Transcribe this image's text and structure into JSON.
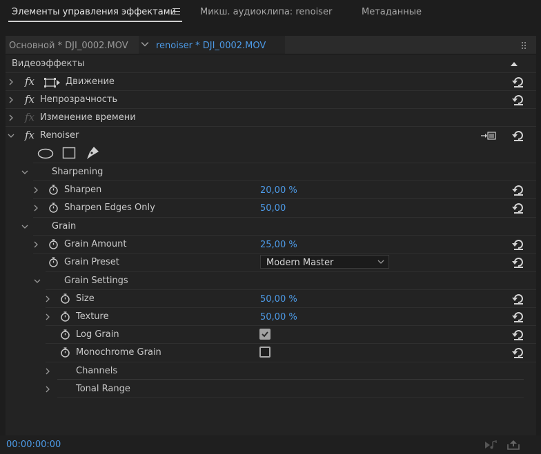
{
  "tabs": [
    {
      "label": "Элементы управления эффектами",
      "active": true
    },
    {
      "label": "Микш. аудиоклипа: renoiser",
      "active": false
    },
    {
      "label": "Метаданные",
      "active": false
    }
  ],
  "sequence": {
    "master": "Основной * DJI_0002.MOV",
    "clip": "renoiser * DJI_0002.MOV"
  },
  "section_header": "Видеоэффекты",
  "effects": {
    "motion": "Движение",
    "opacity": "Непрозрачность",
    "time_remap": "Изменение времени",
    "renoiser": "Renoiser"
  },
  "sharpening": {
    "label": "Sharpening",
    "sharpen": {
      "label": "Sharpen",
      "value": "20,00 %"
    },
    "edges": {
      "label": "Sharpen Edges Only",
      "value": "50,00"
    }
  },
  "grain": {
    "label": "Grain",
    "amount": {
      "label": "Grain Amount",
      "value": "25,00 %"
    },
    "preset": {
      "label": "Grain Preset",
      "value": "Modern Master"
    },
    "settings": {
      "label": "Grain Settings",
      "size": {
        "label": "Size",
        "value": "50,00 %"
      },
      "texture": {
        "label": "Texture",
        "value": "50,00 %"
      },
      "log": {
        "label": "Log Grain",
        "checked": true
      },
      "mono": {
        "label": "Monochrome Grain",
        "checked": false
      }
    },
    "channels": "Channels",
    "tonal_range": "Tonal Range"
  },
  "timecode": "00:00:00:00",
  "colors": {
    "accent": "#4d9be8",
    "background": "#232323"
  }
}
